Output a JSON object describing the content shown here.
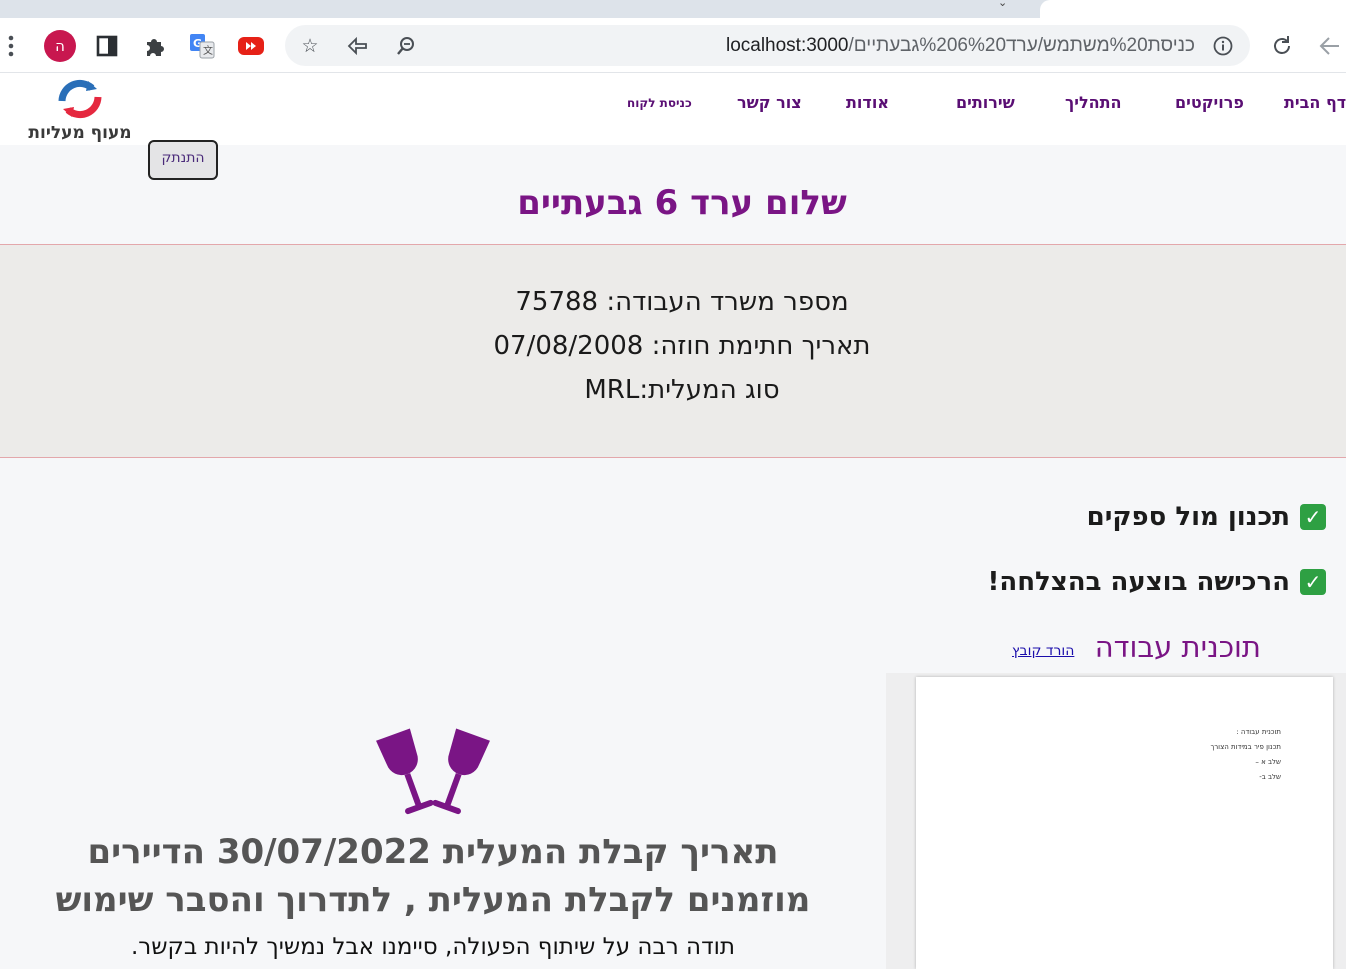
{
  "browser": {
    "profile_initial": "ה",
    "url_host": "localhost:3000",
    "url_path": "/כניסת%20משתמש/ערד%206%20גבעתיים",
    "icons": [
      "menu-kebab-icon",
      "side-panel-icon",
      "extensions-icon",
      "google-translate-icon",
      "youtube-extension-icon",
      "bookmark-star-icon",
      "share-icon",
      "zoom-icon",
      "site-info-icon",
      "reload-icon",
      "back-arrow-icon"
    ]
  },
  "site": {
    "logo_text": "מעוף מעליות",
    "nav": {
      "home": "דף הבית",
      "projects": "פרויקטים",
      "process": "התהליך",
      "services": "שירותים",
      "about": "אודות",
      "contact": "צור קשר",
      "customer_login": "כניסת לקוח"
    },
    "logout_label": "התנתק"
  },
  "greeting": "שלום ערד 6 גבעתיים",
  "info": {
    "labor_office_number": "מספר משרד העבודה: 75788",
    "contract_date": "תאריך חתימת חוזה: 07/08/2008",
    "elevator_type": "סוג המעלית:MRL"
  },
  "checklist": [
    {
      "label": "תכנון מול ספקים",
      "done": true
    },
    {
      "label": "הרכישה בוצעה בהצלחה!",
      "done": true
    }
  ],
  "workplan": {
    "title": "תוכנית עבודה",
    "download_label": "הורד קובץ",
    "document_lines": [
      "תוכנית עבודה :",
      "תכנון פיר במידות הצורך",
      "שלב א –",
      "שלב ב-"
    ]
  },
  "acceptance": {
    "line1": "תאריך קבלת המעלית 30/07/2022 הדיירים",
    "line2": "מוזמנים לקבלת המעלית , לתדרוך והסבר שימוש",
    "thanks": "תודה רבה על שיתוף הפעולה, סיימנו אבל נמשיך להיות בקשר.",
    "icon": "cheers-wine-glasses-icon"
  },
  "colors": {
    "brand_purple": "#7a1585",
    "nav_purple": "#5a0f74",
    "check_green": "#2ea043",
    "logo_blue": "#2a6fb8",
    "logo_red": "#e5283f"
  }
}
